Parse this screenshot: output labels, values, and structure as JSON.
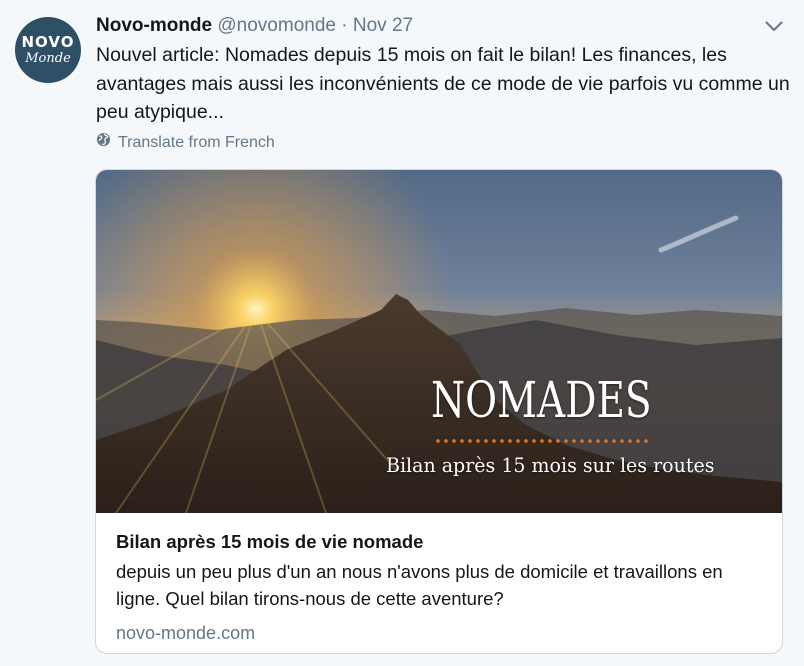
{
  "tweet": {
    "avatar": {
      "top": "NOVO",
      "bottom": "Monde"
    },
    "display_name": "Novo-monde",
    "handle": "@novomonde",
    "separator": "·",
    "date": "Nov 27",
    "text": "Nouvel article: Nomades depuis 15 mois on fait le bilan! Les finances, les avantages mais aussi les inconvénients de ce mode de vie parfois vu comme un peu atypique...",
    "translate_label": "Translate from French"
  },
  "card": {
    "image_title": "NOMADES",
    "image_subtitle": "Bilan après 15 mois sur les routes",
    "title": "Bilan après 15 mois de vie nomade",
    "description": "depuis un peu plus d'un an nous n'avons plus de domicile et travaillons en ligne. Quel bilan tirons-nous de cette aventure?",
    "domain": "novo-monde.com"
  },
  "colors": {
    "background": "#f5f8fa",
    "text_primary": "#14171a",
    "text_secondary": "#657786",
    "card_border": "#ccd6dd",
    "avatar_bg": "#2e4f66",
    "dots_accent": "#e0782a"
  },
  "icons": {
    "chevron": "chevron-down-icon",
    "translate": "globe-icon"
  }
}
